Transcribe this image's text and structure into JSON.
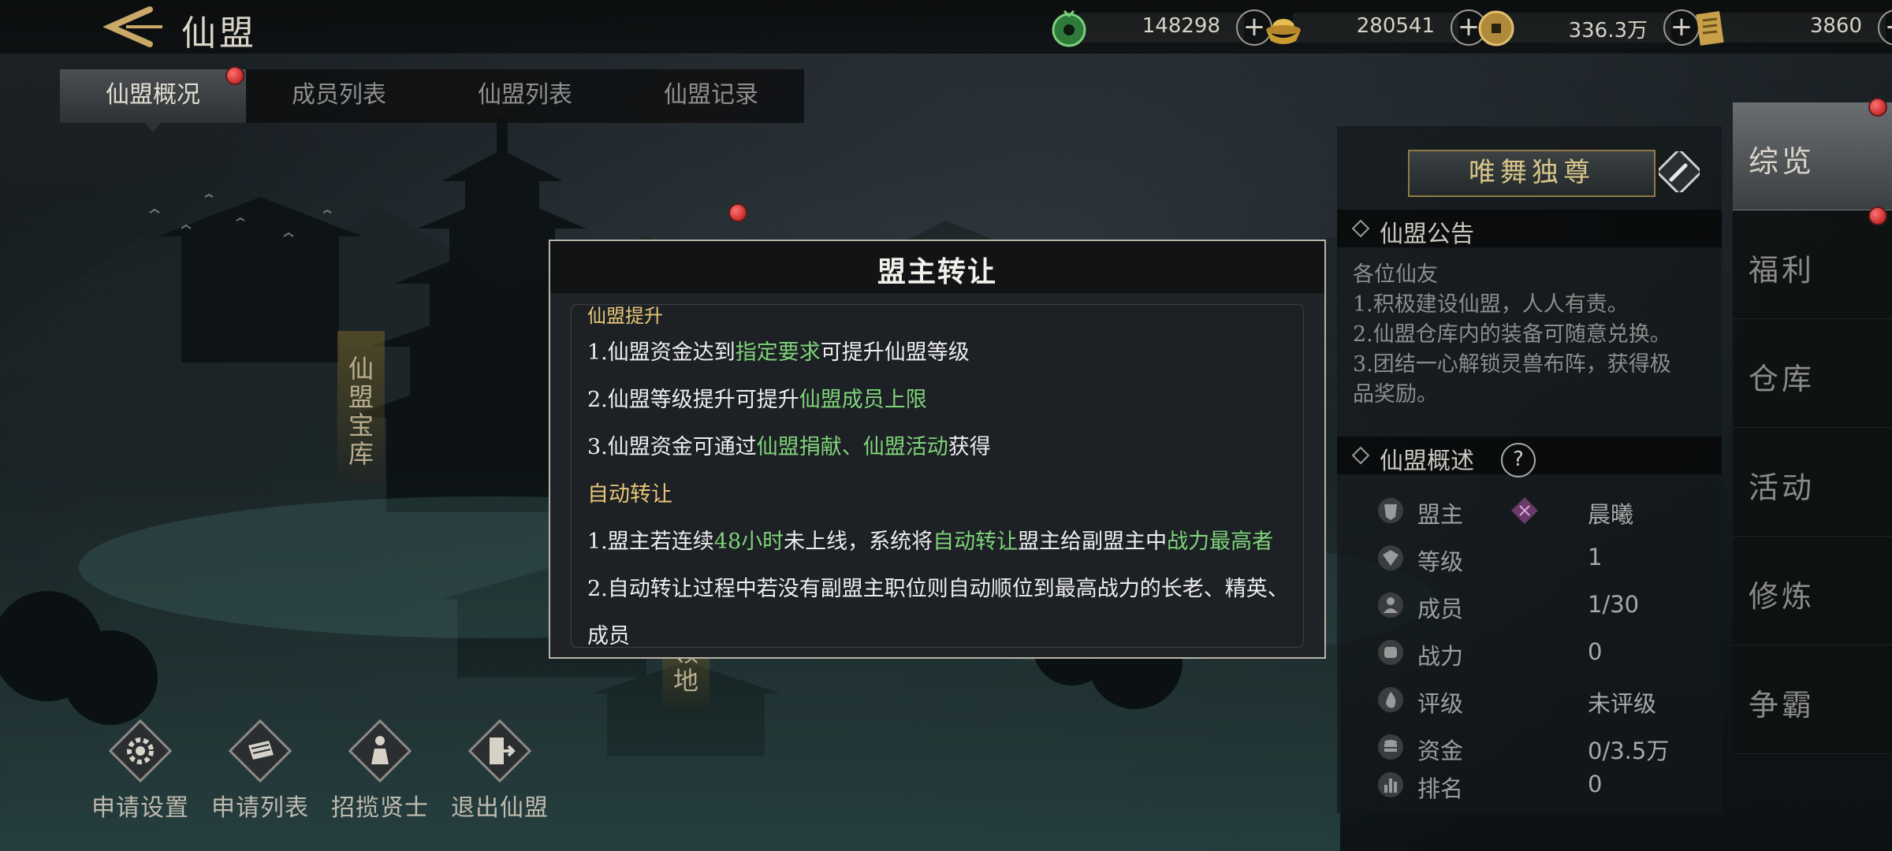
{
  "header": {
    "title": "仙盟",
    "currencies": [
      {
        "icon": "jade-coin-icon",
        "value": "148298"
      },
      {
        "icon": "gold-ingot-icon",
        "value": "280541"
      },
      {
        "icon": "copper-coin-icon",
        "value": "336.3万"
      },
      {
        "icon": "scroll-token-icon",
        "value": "3860"
      }
    ]
  },
  "tabs": [
    {
      "label": "仙盟概况",
      "active": true,
      "badge": true
    },
    {
      "label": "成员列表"
    },
    {
      "label": "仙盟列表"
    },
    {
      "label": "仙盟记录"
    }
  ],
  "scene_labels": {
    "treasury": "仙盟宝库",
    "land": "领地"
  },
  "actions": [
    {
      "label": "申请设置",
      "icon": "gear-icon"
    },
    {
      "label": "申请列表",
      "icon": "book-icon"
    },
    {
      "label": "招揽贤士",
      "icon": "recruit-figure-icon"
    },
    {
      "label": "退出仙盟",
      "icon": "exit-door-icon"
    }
  ],
  "info_panel": {
    "guild_name": "唯舞独尊",
    "notice_title": "仙盟公告",
    "notice_lines": [
      "各位仙友",
      "1.积极建设仙盟，人人有责。",
      "2.仙盟仓库内的装备可随意兑换。",
      "3.团结一心解锁灵兽布阵，获得极",
      "品奖励。"
    ],
    "overview_title": "仙盟概述",
    "stats": [
      {
        "key": "盟主",
        "value": "晨曦"
      },
      {
        "key": "等级",
        "value": "1"
      },
      {
        "key": "成员",
        "value": "1/30"
      },
      {
        "key": "战力",
        "value": "0"
      },
      {
        "key": "评级",
        "value": "未评级"
      },
      {
        "key": "资金",
        "value": "0/3.5万"
      },
      {
        "key": "排名",
        "value": "0"
      }
    ]
  },
  "side_nav": [
    {
      "label": "综览",
      "active": true
    },
    {
      "label": "福利"
    },
    {
      "label": "仓库"
    },
    {
      "label": "活动"
    },
    {
      "label": "修炼"
    },
    {
      "label": "争霸"
    }
  ],
  "modal": {
    "title": "盟主转让",
    "section1_title": "仙盟提升",
    "s1_l1": {
      "a": "1.仙盟资金达到",
      "b": "指定要求",
      "c": "可提升仙盟等级"
    },
    "s1_l2": {
      "a": "2.仙盟等级提升可提升",
      "b": "仙盟成员上限"
    },
    "s1_l3": {
      "a": "3.仙盟资金可通过",
      "b": "仙盟捐献、仙盟活动",
      "c": "获得"
    },
    "section2_title": "自动转让",
    "s2_l1": {
      "a": "1.盟主若连续",
      "b": "48小时",
      "c": "未上线，系统将",
      "d": "自动转让",
      "e": "盟主给副盟主中",
      "f": "战力最高者"
    },
    "s2_l2": "2.自动转让过程中若没有副盟主职位则自动顺位到最高战力的长老、精英、",
    "s2_l3": "成员"
  },
  "colors": {
    "highlight": "#7fd37a",
    "section_title": "#e7c678",
    "gold_border": "#8f7a45"
  }
}
